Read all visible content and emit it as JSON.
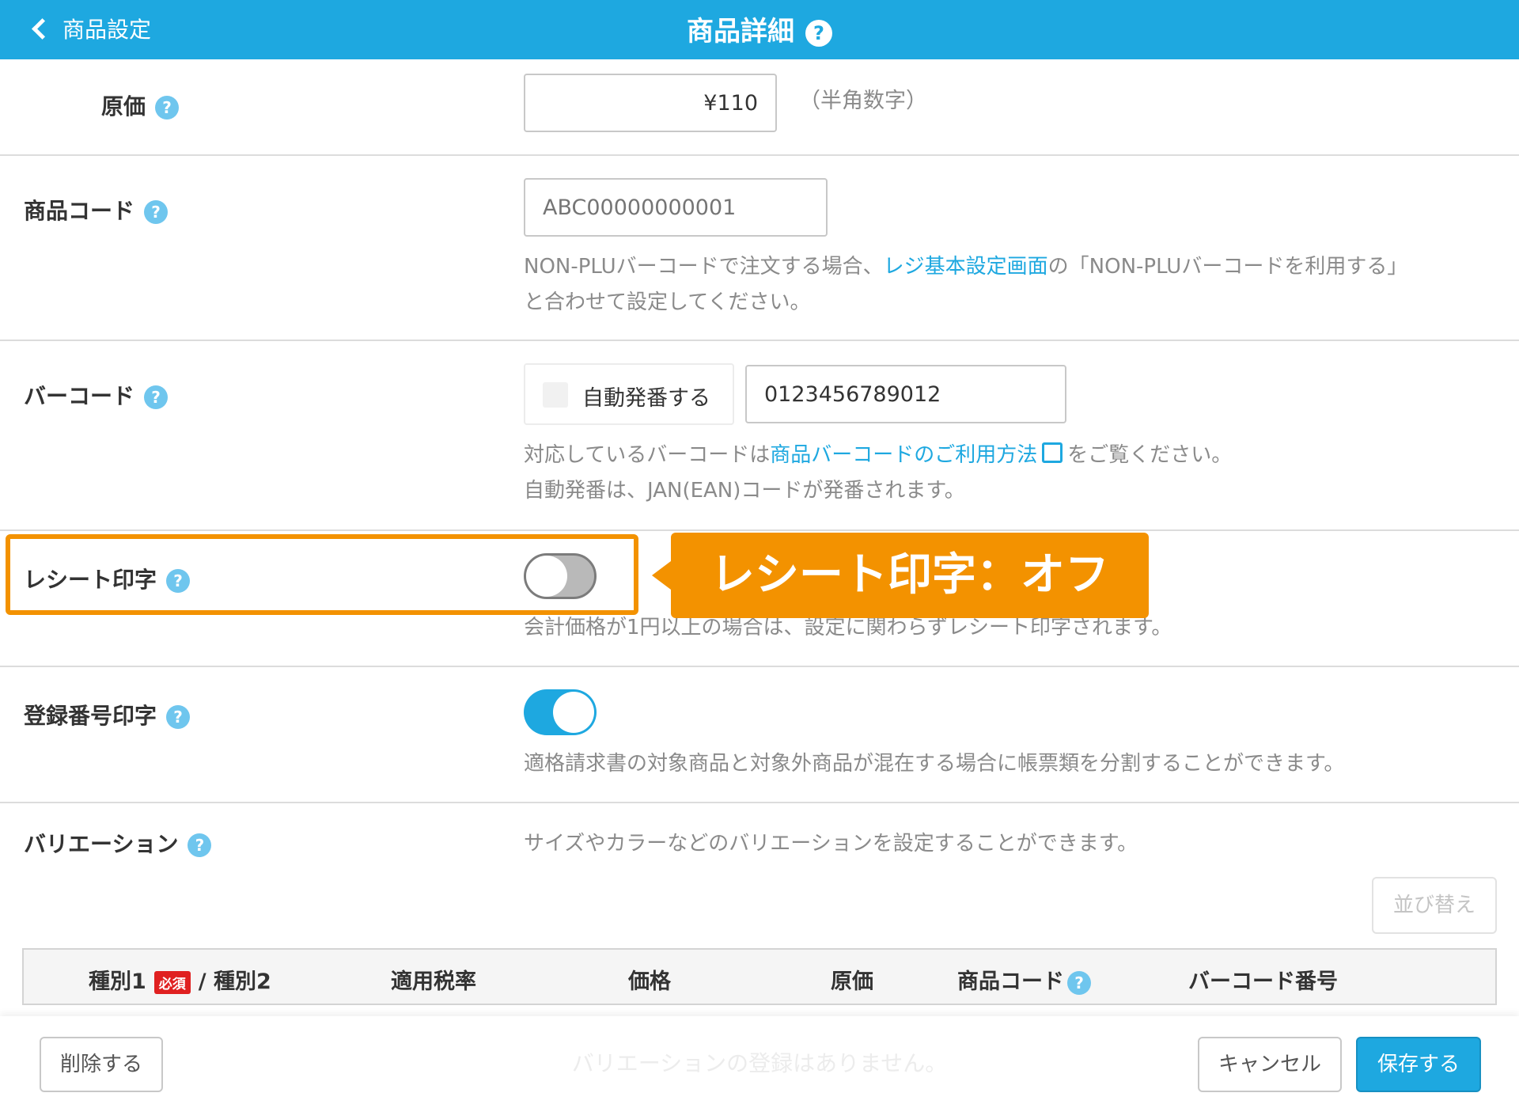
{
  "header": {
    "back_label": "商品設定",
    "title": "商品詳細"
  },
  "cost": {
    "label": "原価",
    "value": "¥110",
    "hint": "（半角数字）"
  },
  "product_code": {
    "label": "商品コード",
    "placeholder": "ABC00000000001",
    "note_pre": "NON-PLUバーコードで注文する場合、",
    "note_link": "レジ基本設定画面",
    "note_post": "の「NON-PLUバーコードを利用する」",
    "note_line2": "と合わせて設定してください。"
  },
  "barcode": {
    "label": "バーコード",
    "auto_label": "自動発番する",
    "value": "0123456789012",
    "note_pre": "対応しているバーコードは",
    "note_link": "商品バーコードのご利用方法",
    "note_post": "をご覧ください。",
    "note_line2": "自動発番は、JAN(EAN)コードが発番されます。"
  },
  "receipt_print": {
    "label": "レシート印字",
    "enabled": false,
    "note": "会計価格が1円以上の場合は、設定に関わらずレシート印字されます。",
    "callout": "レシート印字：オフ"
  },
  "registration_print": {
    "label": "登録番号印字",
    "enabled": true,
    "note": "適格請求書の対象商品と対象外商品が混在する場合に帳票類を分割することができます。"
  },
  "variation": {
    "label": "バリエーション",
    "note": "サイズやカラーなどのバリエーションを設定することができます。",
    "sort_label": "並び替え",
    "columns": {
      "type1": "種別1",
      "required": "必須",
      "type2": "/ 種別2",
      "tax": "適用税率",
      "price": "価格",
      "cost": "原価",
      "code": "商品コード",
      "barcode": "バーコード番号"
    },
    "empty": "バリエーションの登録はありません。"
  },
  "footer": {
    "delete_label": "削除する",
    "cancel_label": "キャンセル",
    "save_label": "保存する"
  },
  "colors": {
    "accent": "#1ea8e0",
    "callout": "#f39200",
    "required": "#e02020"
  }
}
